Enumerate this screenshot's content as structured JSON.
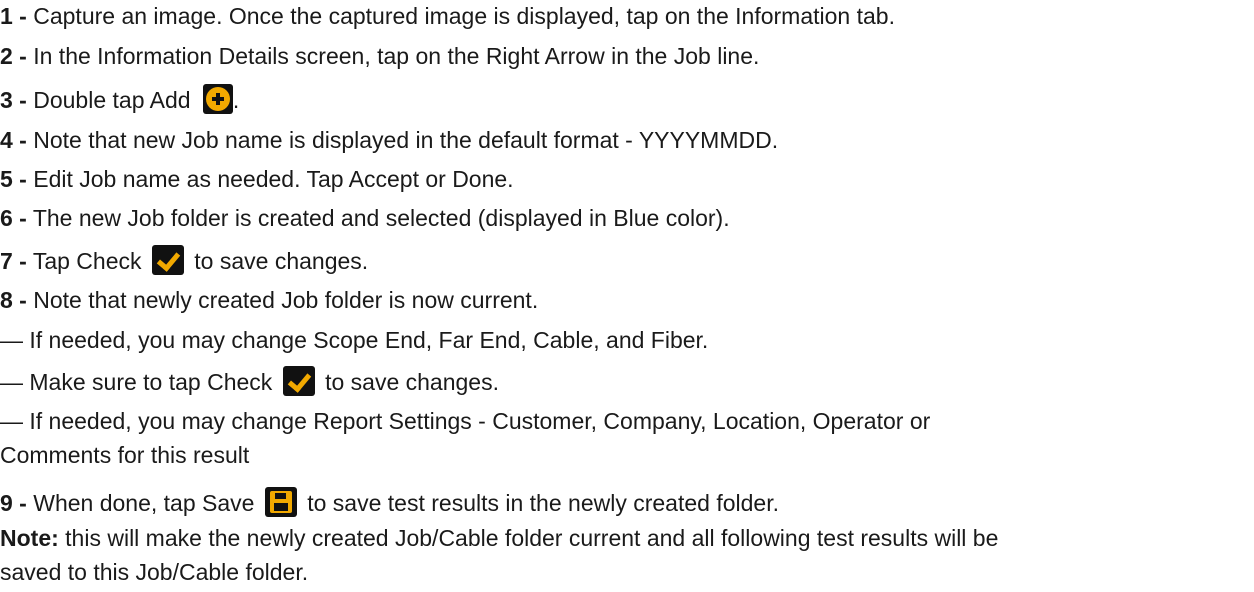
{
  "steps": [
    {
      "num": "1 -",
      "text": "Capture an image. Once the captured image is displayed, tap on the Information tab."
    },
    {
      "num": "2 -",
      "text": "In the Information Details screen, tap on the Right Arrow in the Job line."
    },
    {
      "num": "3 -",
      "text_before": "Double tap Add ",
      "text_after": "."
    },
    {
      "num": "4 -",
      "text": "Note that new Job name is displayed in the default format - YYYYMMDD."
    },
    {
      "num": "5 -",
      "text": "Edit Job name as needed. Tap Accept or Done."
    },
    {
      "num": "6 -",
      "text": "The new Job folder is created and selected (displayed in Blue color)."
    },
    {
      "num": "7 -",
      "text_before": "Tap Check ",
      "text_after": " to save changes."
    },
    {
      "num": "8 -",
      "text": "Note that newly created Job folder is now current."
    }
  ],
  "sub_items": [
    {
      "text": "— If needed, you may change Scope End, Far End, Cable, and Fiber."
    },
    {
      "text_before": "— Make sure to tap Check ",
      "text_after": " to save changes."
    },
    {
      "line1": "— If needed, you may change Report Settings - Customer, Company, Location, Operator or",
      "line2": "Comments for this result"
    }
  ],
  "step9": {
    "num": "9 -",
    "text_before": "When done, tap Save ",
    "text_after": " to save test results in the newly created folder."
  },
  "note": {
    "label": "Note:",
    "line1": " this will make the newly created Job/Cable folder current and all following test results will be",
    "line2": "saved to this Job/Cable folder."
  },
  "icons": {
    "add": "add-circle-icon",
    "check": "check-icon",
    "save": "save-disk-icon"
  },
  "colors": {
    "icon_bg": "#111111",
    "icon_accent": "#f2a900"
  }
}
